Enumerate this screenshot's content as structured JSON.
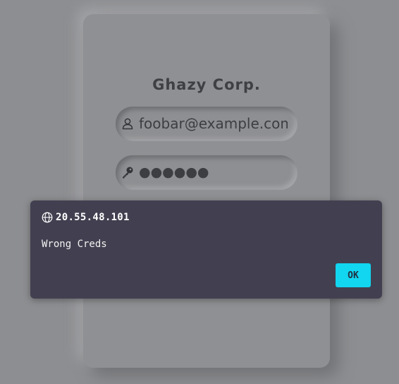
{
  "login": {
    "title": "Ghazy Corp.",
    "email_value": "foobar@example.com",
    "password_value": "●●●●●●",
    "email_icon": "user-icon",
    "password_icon": "key-icon"
  },
  "alert": {
    "host": "20.55.48.101",
    "message": "Wrong Creds",
    "ok_label": "OK",
    "icon": "globe-icon"
  },
  "colors": {
    "background": "#8d8e91",
    "dialog": "#424050",
    "ok_button": "#12d5f0"
  }
}
